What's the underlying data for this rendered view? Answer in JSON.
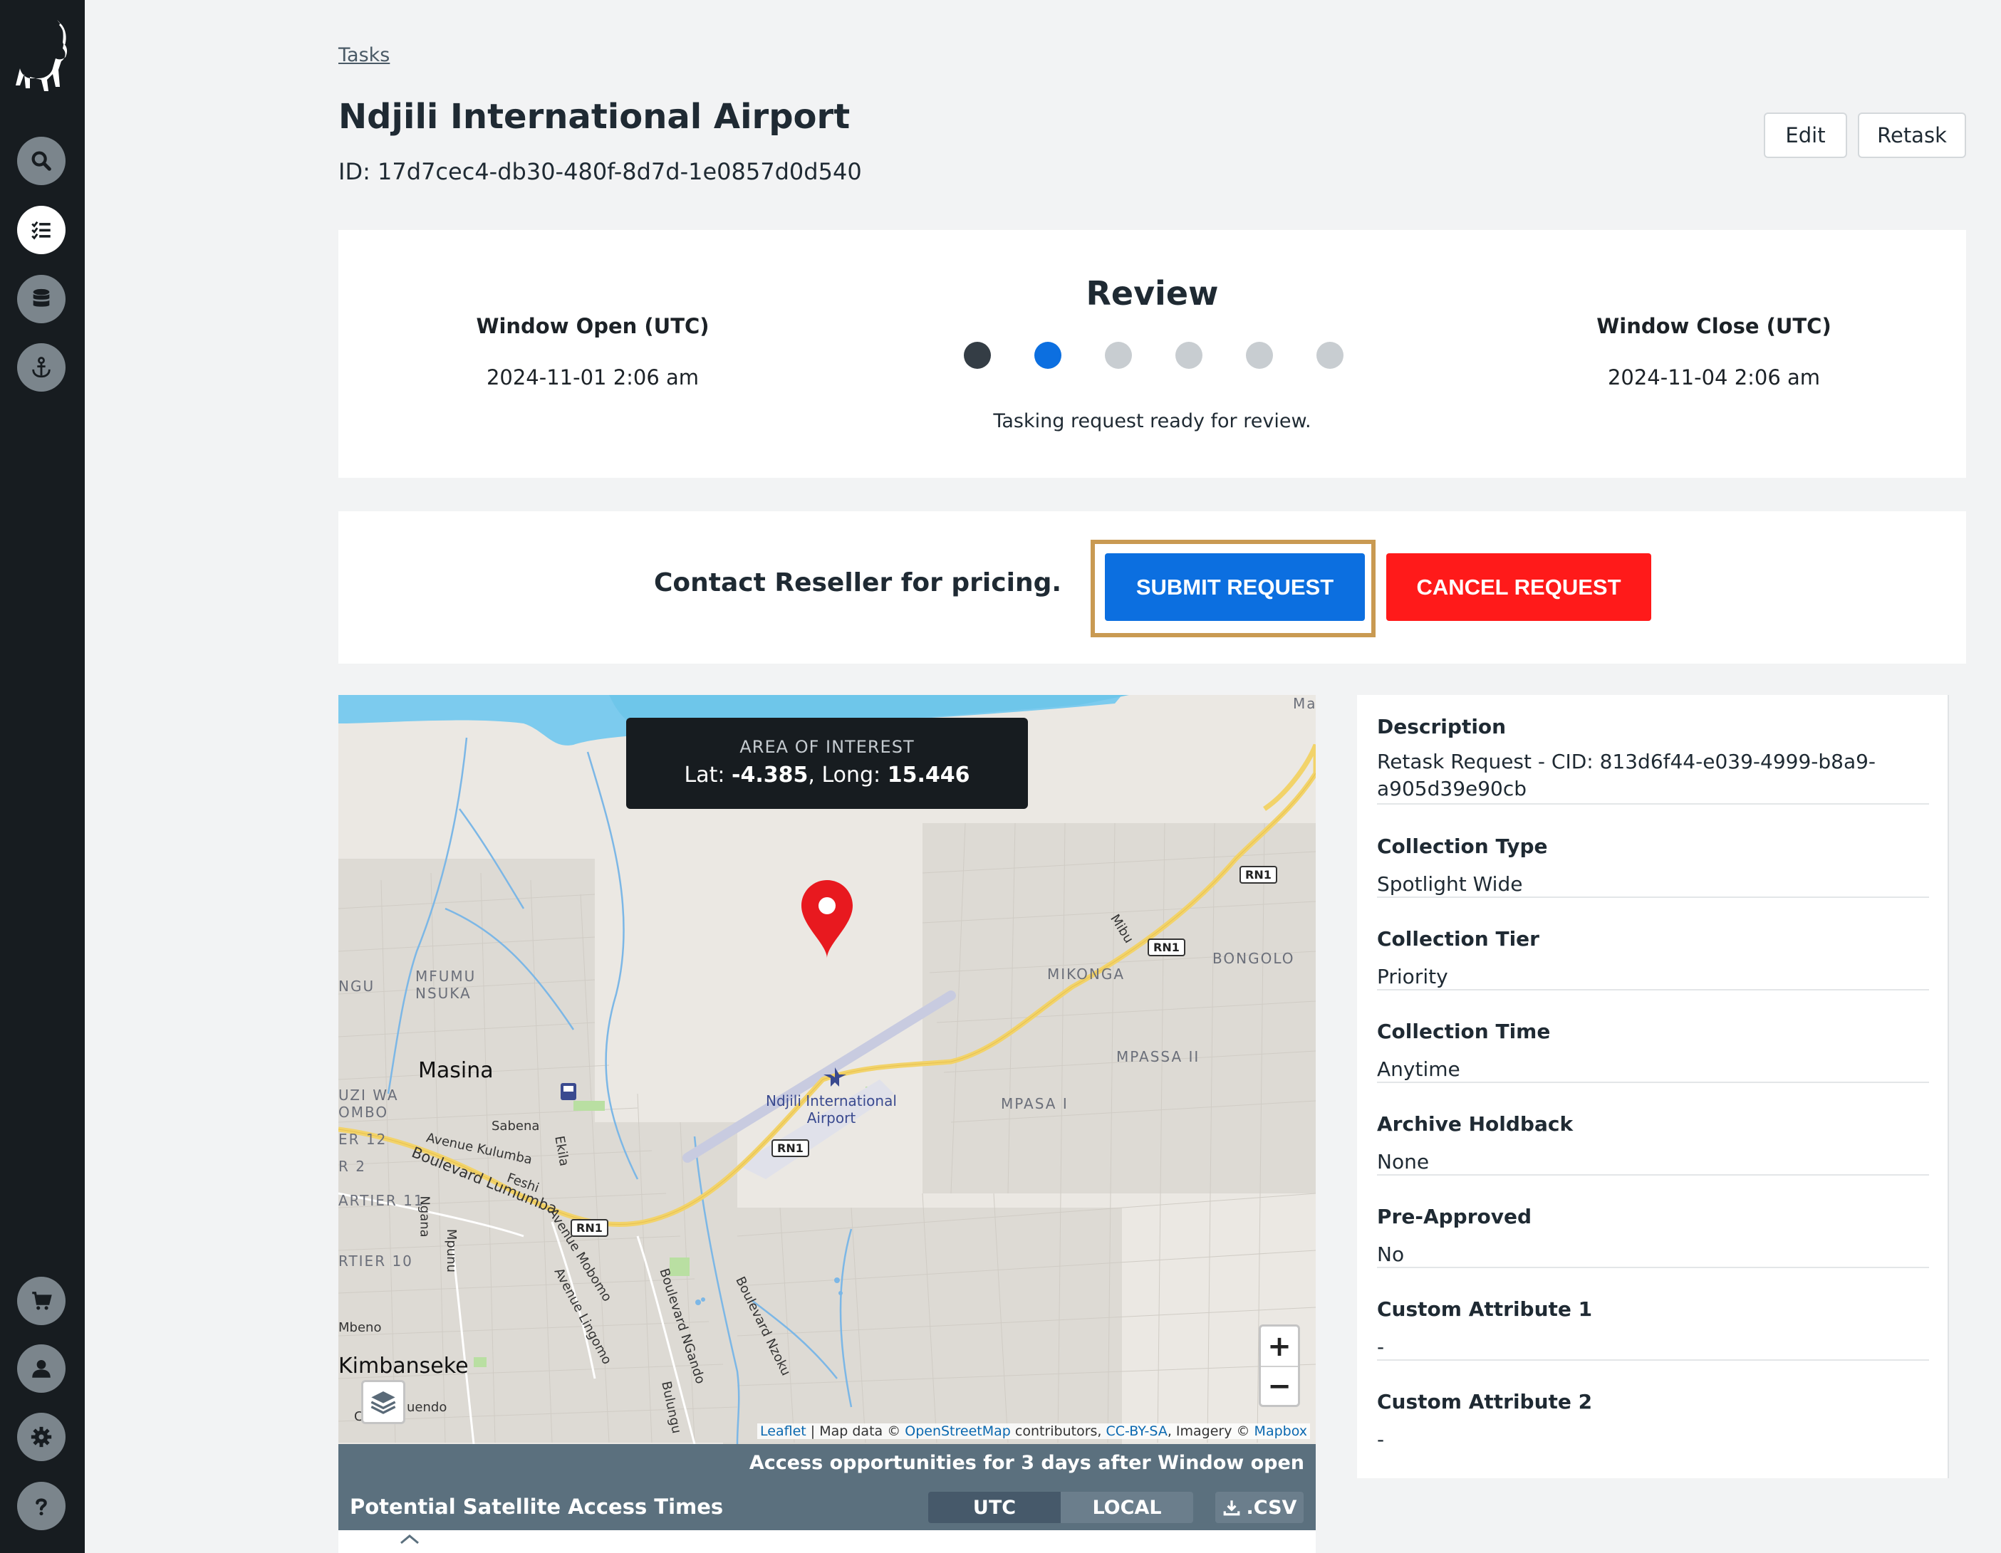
{
  "breadcrumb": "Tasks",
  "title": "Ndjili International Airport",
  "task_id": "ID: 17d7cec4-db30-480f-8d7d-1e0857d0d540",
  "header_buttons": {
    "edit": "Edit",
    "retask": "Retask"
  },
  "review": {
    "title": "Review",
    "window_open_label": "Window Open (UTC)",
    "window_open_value": "2024-11-01 2:06 am",
    "window_close_label": "Window Close (UTC)",
    "window_close_value": "2024-11-04 2:06 am",
    "status_text": "Tasking request ready for review.",
    "steps_total": 6,
    "current_step": 2
  },
  "pricing": {
    "text": "Contact Reseller for pricing.",
    "submit_label": "SUBMIT REQUEST",
    "cancel_label": "CANCEL REQUEST"
  },
  "map": {
    "aoi_title": "AREA OF INTEREST",
    "lat_label": "Lat:",
    "lat_value": "-4.385",
    "long_label": "Long:",
    "long_value": "15.446",
    "labels": {
      "masina": "Masina",
      "kimbanseke": "Kimbanseke",
      "mfumu": "MFUMU",
      "nsuka": "NSUKA",
      "mikonga": "MIKONGA",
      "bongolo": "BONGOLO",
      "mpassa2": "MPASSA II",
      "mpasa1": "MPASA I",
      "ngu": "NGU",
      "uzi_wa": "UZI WA",
      "ombo": "OMBO",
      "er12": "ER 12",
      "r2": "R 2",
      "artier11": "ARTIER 11",
      "rtier10": "RTIER 10",
      "mbeno": "Mbeno",
      "ma": "Ma",
      "sabena": "Sabena",
      "av_kulumba": "Avenue Kulumba",
      "ekila": "Ekila",
      "feshi": "Feshi",
      "bd_lumumba": "Boulevard Lumumba",
      "nganga": "Ngana",
      "mpunu": "Mpunu",
      "av_mobomo": "Avenue Mobomo",
      "av_lingumo": "Avenue Lingomo",
      "bd_ngando": "Boulevard NGando",
      "bd_nzoku": "Boulevard Nzoku",
      "bulungu": "Bulungu",
      "mibu": "Mibu",
      "uendo": "uendo",
      "c": "C",
      "airport_line1": "Ndjili International",
      "airport_line2": "Airport",
      "rn1": "RN1"
    },
    "zoom_in": "+",
    "zoom_out": "−",
    "attribution": {
      "leaflet": "Leaflet",
      "sep1": " | Map data © ",
      "osm": "OpenStreetMap",
      "sep2": " contributors, ",
      "ccbysa": "CC-BY-SA",
      "sep3": ", Imagery © ",
      "mapbox": "Mapbox"
    }
  },
  "access": {
    "note": "Access opportunities for 3 days after Window open",
    "title": "Potential Satellite Access Times",
    "utc_label": "UTC",
    "local_label": "LOCAL",
    "csv_label": ".CSV"
  },
  "details": [
    {
      "label": "Description",
      "value": "Retask Request - CID: 813d6f44-e039-4999-b8a9-a905d39e90cb"
    },
    {
      "label": "Collection Type",
      "value": "Spotlight Wide"
    },
    {
      "label": "Collection Tier",
      "value": "Priority"
    },
    {
      "label": "Collection Time",
      "value": "Anytime"
    },
    {
      "label": "Archive Holdback",
      "value": "None"
    },
    {
      "label": "Pre-Approved",
      "value": "No"
    },
    {
      "label": "Custom Attribute 1",
      "value": "-"
    },
    {
      "label": "Custom Attribute 2",
      "value": "-"
    }
  ],
  "icons": {
    "nav": [
      "search-icon",
      "task-list-icon",
      "database-icon",
      "anchor-icon",
      "cart-icon",
      "user-icon",
      "gear-icon",
      "help-icon"
    ],
    "accent_blue": "#0c6fe0",
    "accent_red": "#ff1a1a",
    "sidebar_bg": "#171c20"
  }
}
